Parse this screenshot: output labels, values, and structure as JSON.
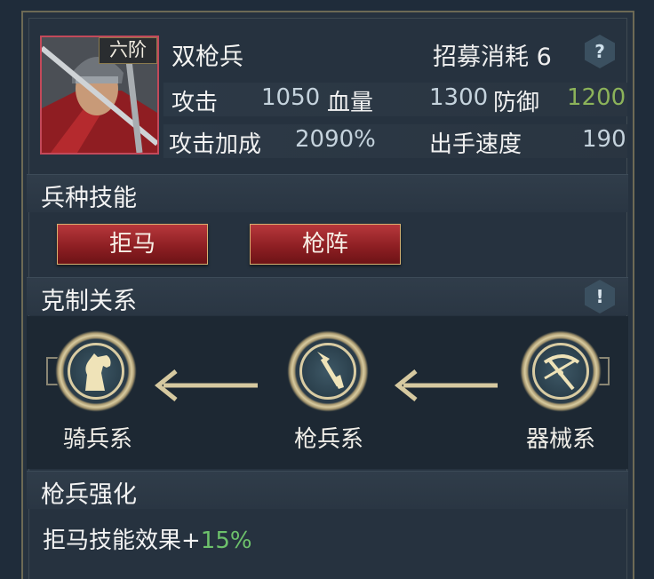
{
  "unit": {
    "name": "双枪兵",
    "rank": "六阶",
    "recruit_label": "招募消耗",
    "recruit_cost": "6",
    "help_icon": "?",
    "stats": {
      "attack_label": "攻击",
      "attack": "1050",
      "hp_label": "血量",
      "hp": "1300",
      "defense_label": "防御",
      "defense": "1200",
      "attack_bonus_label": "攻击加成",
      "attack_bonus": "2090%",
      "speed_label": "出手速度",
      "speed": "190"
    }
  },
  "sections": {
    "skills_title": "兵种技能",
    "counter_title": "克制关系",
    "enhance_title": "枪兵强化"
  },
  "skills": [
    "拒马",
    "枪阵"
  ],
  "counter": {
    "info_icon": "!",
    "nodes": [
      {
        "label": "骑兵系",
        "icon": "horse-icon"
      },
      {
        "label": "枪兵系",
        "icon": "spear-icon"
      },
      {
        "label": "器械系",
        "icon": "crossbow-icon"
      }
    ]
  },
  "enhancement": {
    "text": "拒马技能效果+",
    "value": "15%"
  },
  "colors": {
    "skill_button": "#a82c30",
    "green_value": "#8cb35a",
    "bonus_green": "#6dc16b",
    "gold": "#d9cca3"
  }
}
